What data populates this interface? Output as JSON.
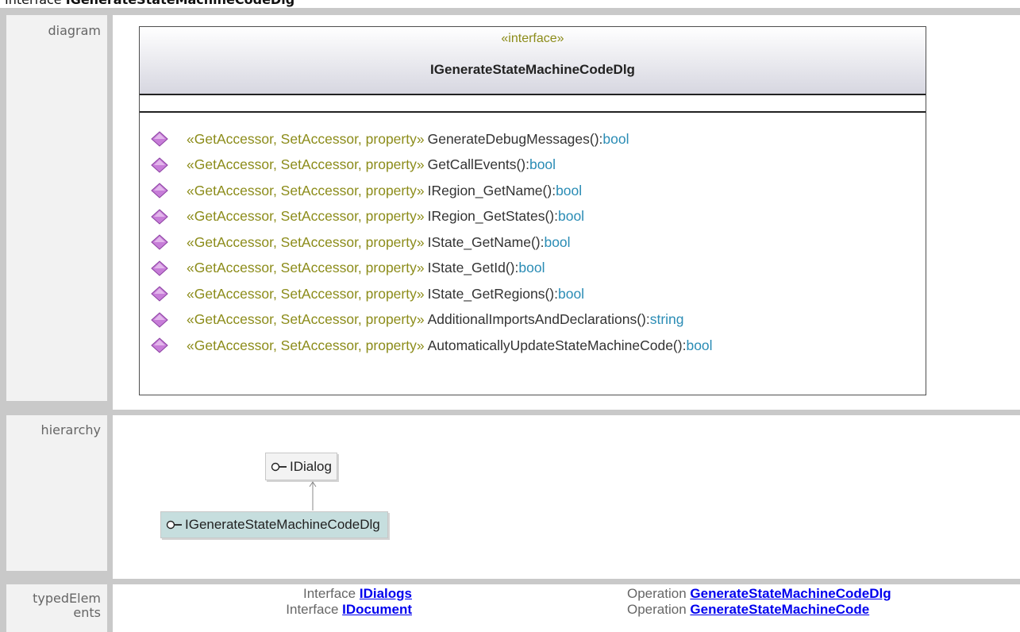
{
  "page": {
    "heading_kind": "Interface",
    "heading_name": "IGenerateStateMachineCodeDlg"
  },
  "rows": {
    "diagram": "diagram",
    "hierarchy": "hierarchy",
    "typed_elements": "typedElem\nents"
  },
  "diagram": {
    "stereotype": "«interface»",
    "name": "IGenerateStateMachineCodeDlg",
    "operations": [
      {
        "stereotype": "«GetAccessor, SetAccessor, property»",
        "name": "GenerateDebugMessages():",
        "type": "bool"
      },
      {
        "stereotype": "«GetAccessor, SetAccessor, property»",
        "name": "GetCallEvents():",
        "type": "bool"
      },
      {
        "stereotype": "«GetAccessor, SetAccessor, property»",
        "name": "IRegion_GetName():",
        "type": "bool"
      },
      {
        "stereotype": "«GetAccessor, SetAccessor, property»",
        "name": "IRegion_GetStates():",
        "type": "bool"
      },
      {
        "stereotype": "«GetAccessor, SetAccessor, property»",
        "name": "IState_GetName():",
        "type": "bool"
      },
      {
        "stereotype": "«GetAccessor, SetAccessor, property»",
        "name": "IState_GetId():",
        "type": "bool"
      },
      {
        "stereotype": "«GetAccessor, SetAccessor, property»",
        "name": "IState_GetRegions():",
        "type": "bool"
      },
      {
        "stereotype": "«GetAccessor, SetAccessor, property»",
        "name": "AdditionalImportsAndDeclarations():",
        "type": "string"
      },
      {
        "stereotype": "«GetAccessor, SetAccessor, property»",
        "name": "AutomaticallyUpdateStateMachineCode():",
        "type": "bool"
      }
    ]
  },
  "hierarchy": {
    "parent": "IDialog",
    "child": "IGenerateStateMachineCodeDlg"
  },
  "typed_elements": [
    {
      "kind": "Interface",
      "name": "IDialogs"
    },
    {
      "kind": "Interface",
      "name": "IDocument"
    },
    {
      "kind": "Operation",
      "name": "GenerateStateMachineCodeDlg"
    },
    {
      "kind": "Operation",
      "name": "GenerateStateMachineCode"
    }
  ],
  "icons": {
    "operation": "diamond-operation-icon",
    "interface": "interface-lollipop-icon"
  },
  "colors": {
    "stereotype": "#8c8c1a",
    "type": "#2a8cb5",
    "operation_icon": "#c77dd8",
    "link": "#0000ee",
    "hierarchy_child_bg": "#c6dede"
  }
}
